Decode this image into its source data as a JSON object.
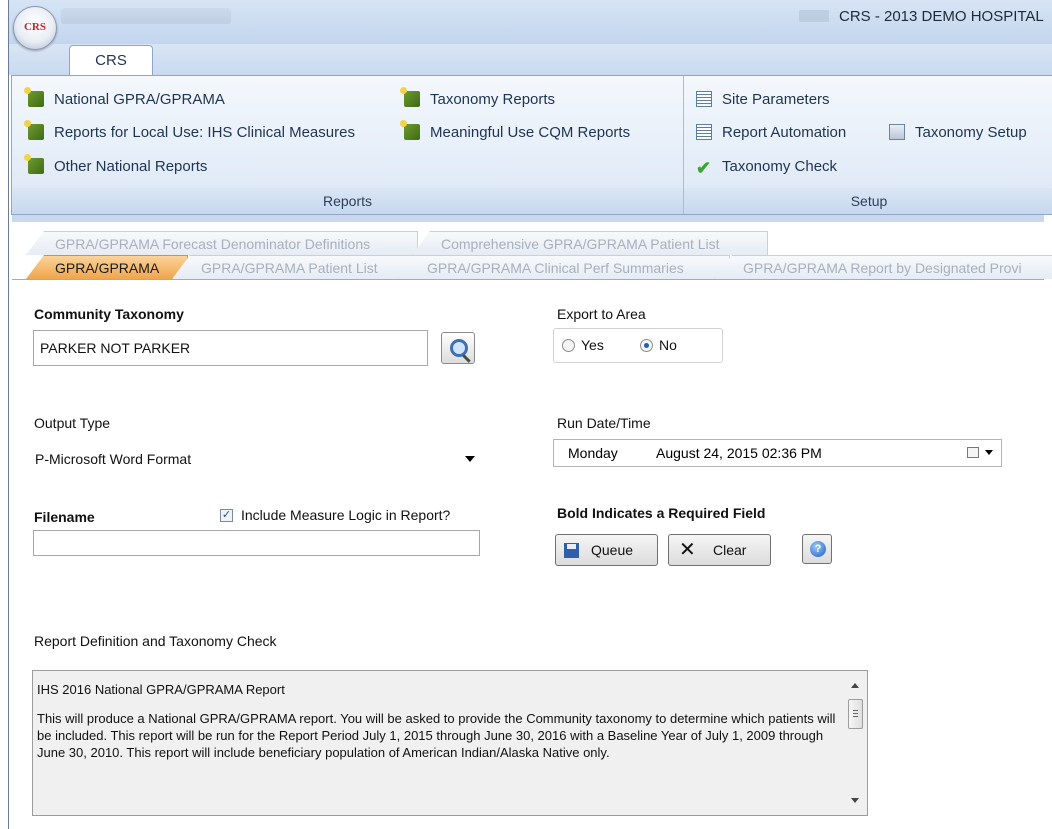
{
  "window": {
    "title": "CRS - 2013 DEMO HOSPITAL",
    "orb_label": "CRS"
  },
  "ribbon": {
    "tab_label": "CRS",
    "reports_group": {
      "label": "Reports",
      "items": [
        {
          "label": "National GPRA/GPRAMA",
          "icon": "report-icon"
        },
        {
          "label": "Reports for Local Use: IHS Clinical Measures",
          "icon": "report-icon"
        },
        {
          "label": "Other National Reports",
          "icon": "report-icon"
        },
        {
          "label": "Taxonomy Reports",
          "icon": "report-icon"
        },
        {
          "label": "Meaningful Use CQM Reports",
          "icon": "report-icon"
        }
      ]
    },
    "setup_group": {
      "label": "Setup",
      "items": [
        {
          "label": "Site Parameters",
          "icon": "list-icon"
        },
        {
          "label": "Report Automation",
          "icon": "list-icon"
        },
        {
          "label": "Taxonomy Setup",
          "icon": "taxonomy-setup-icon"
        },
        {
          "label": "Taxonomy Check",
          "icon": "checkmark-icon"
        }
      ]
    }
  },
  "doc_tabs": {
    "row1": [
      "GPRA/GPRAMA Forecast Denominator Definitions",
      "Comprehensive GPRA/GPRAMA Patient List"
    ],
    "row2": [
      "GPRA/GPRAMA",
      "GPRA/GPRAMA Patient List",
      "GPRA/GPRAMA Clinical Perf Summaries",
      "GPRA/GPRAMA Report by Designated Provi"
    ],
    "active": "GPRA/GPRAMA"
  },
  "form": {
    "community_taxonomy": {
      "label": "Community Taxonomy",
      "value": "PARKER NOT PARKER"
    },
    "export_to_area": {
      "label": "Export to Area",
      "options": [
        "Yes",
        "No"
      ],
      "selected": "No"
    },
    "output_type": {
      "label": "Output Type",
      "value": "P-Microsoft Word Format"
    },
    "run_datetime": {
      "label": "Run Date/Time",
      "weekday": "Monday",
      "date": "August  24, 2015  02:36 PM"
    },
    "filename": {
      "label": "Filename",
      "value": ""
    },
    "include_logic": {
      "label": "Include Measure Logic in Report?",
      "checked": true
    },
    "required_note": "Bold Indicates a Required Field",
    "buttons": {
      "queue": "Queue",
      "clear": "Clear",
      "help": "?"
    },
    "report_definition": {
      "label": "Report Definition and Taxonomy Check",
      "paragraphs": [
        "IHS 2016 National GPRA/GPRAMA Report",
        "This will produce a National GPRA/GPRAMA report.  You will be asked to provide the Community taxonomy to determine which patients will be included.  This report will be run for the Report Period July 1, 2015 through June 30, 2016 with a Baseline Year of July 1, 2009 through June 30, 2010. This report will include beneficiary population of American Indian/Alaska Native only."
      ]
    }
  }
}
